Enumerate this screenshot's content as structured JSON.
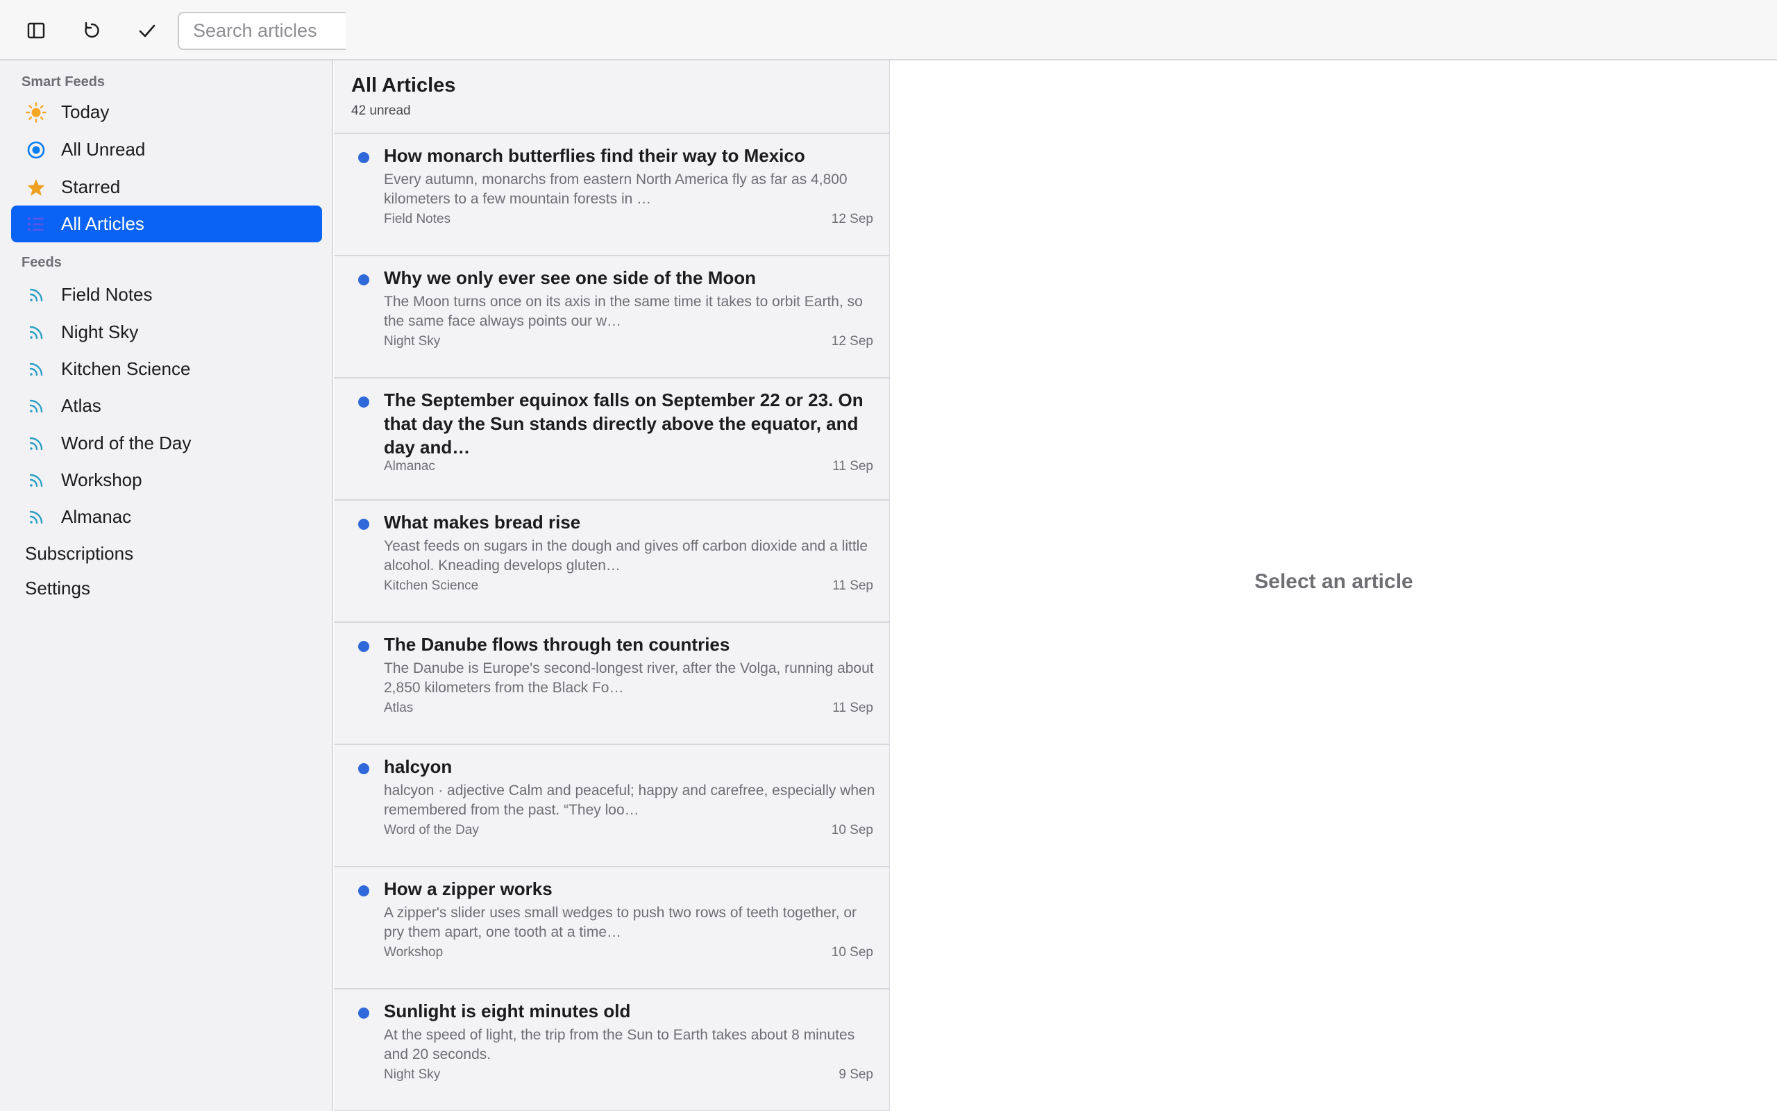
{
  "toolbar": {
    "sidebar_toggle_icon": "sidebar-toggle-icon",
    "refresh_icon": "refresh-icon",
    "mark_read_icon": "checkmark-icon",
    "search_placeholder": "Search articles",
    "search_value": ""
  },
  "sidebar": {
    "smart_feeds_label": "Smart Feeds",
    "smart_feeds": [
      {
        "label": "Today",
        "icon": "sun-icon"
      },
      {
        "label": "All Unread",
        "icon": "unread-circle-icon"
      },
      {
        "label": "Starred",
        "icon": "star-icon"
      },
      {
        "label": "All Articles",
        "icon": "list-icon",
        "active": true
      }
    ],
    "feeds_label": "Feeds",
    "feeds": [
      {
        "label": "Field Notes",
        "icon": "rss-icon"
      },
      {
        "label": "Night Sky",
        "icon": "rss-icon"
      },
      {
        "label": "Kitchen Science",
        "icon": "rss-icon"
      },
      {
        "label": "Atlas",
        "icon": "rss-icon"
      },
      {
        "label": "Word of the Day",
        "icon": "rss-icon"
      },
      {
        "label": "Workshop",
        "icon": "rss-icon"
      },
      {
        "label": "Almanac",
        "icon": "rss-icon"
      }
    ],
    "subscriptions_label": "Subscriptions",
    "settings_label": "Settings"
  },
  "list": {
    "title": "All Articles",
    "subtitle": "42 unread",
    "articles": [
      {
        "title": "How monarch butterflies find their way to Mexico",
        "excerpt": "Every autumn, monarchs from eastern North America fly as far as 4,800 kilometers to a few mountain forests in …",
        "source": "Field Notes",
        "date": "12 Sep",
        "unread": true
      },
      {
        "title": "Why we only ever see one side of the Moon",
        "excerpt": "The Moon turns once on its axis in the same time it takes to orbit Earth, so the same face always points our w…",
        "source": "Night Sky",
        "date": "12 Sep",
        "unread": true
      },
      {
        "title": "The September equinox falls on September 22 or 23. On that day the Sun stands directly above the equator, and day and…",
        "excerpt": "",
        "source": "Almanac",
        "date": "11 Sep",
        "unread": true
      },
      {
        "title": "What makes bread rise",
        "excerpt": "Yeast feeds on sugars in the dough and gives off carbon dioxide and a little alcohol. Kneading develops gluten…",
        "source": "Kitchen Science",
        "date": "11 Sep",
        "unread": true
      },
      {
        "title": "The Danube flows through ten countries",
        "excerpt": "The Danube is Europe's second-longest river, after the Volga, running about 2,850 kilometers from the Black Fo…",
        "source": "Atlas",
        "date": "11 Sep",
        "unread": true
      },
      {
        "title": "halcyon",
        "excerpt": "halcyon · adjective Calm and peaceful; happy and carefree, especially when remembered from the past. “They loo…",
        "source": "Word of the Day",
        "date": "10 Sep",
        "unread": true
      },
      {
        "title": "How a zipper works",
        "excerpt": "A zipper's slider uses small wedges to push two rows of teeth together, or pry them apart, one tooth at a time…",
        "source": "Workshop",
        "date": "10 Sep",
        "unread": true
      },
      {
        "title": "Sunlight is eight minutes old",
        "excerpt": "At the speed of light, the trip from the Sun to Earth takes about 8 minutes and 20 seconds.",
        "source": "Night Sky",
        "date": "9 Sep",
        "unread": true
      }
    ]
  },
  "reader": {
    "empty_message": "Select an article"
  },
  "colors": {
    "accent": "#0a63f4",
    "unread_dot": "#2f68d8",
    "sun": "#f5a623",
    "star": "#f0a020",
    "rss": "#2a9fc4"
  }
}
